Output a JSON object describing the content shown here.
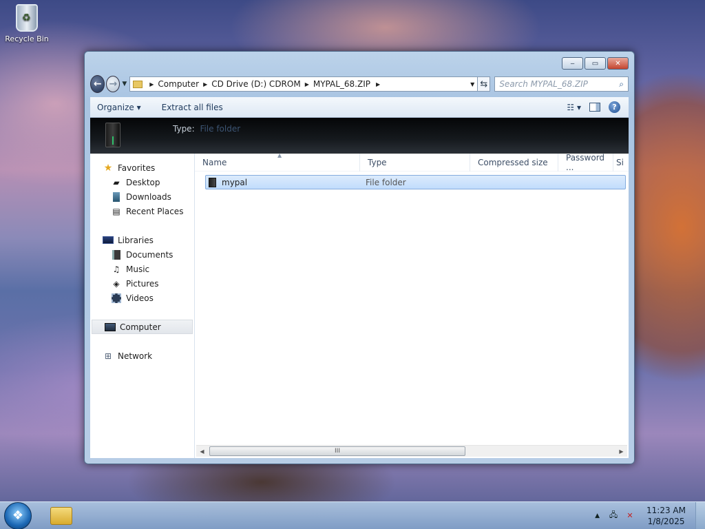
{
  "desktop": {
    "icons": [
      {
        "label": "Recycle Bin",
        "icon": "recycle-bin-icon"
      }
    ]
  },
  "window": {
    "controls": {
      "minimize": "‒",
      "maximize": "▭",
      "close": "✕"
    },
    "nav": {
      "back_glyph": "←",
      "forward_glyph": "→",
      "history_glyph": "▼"
    },
    "address": {
      "crumbs": [
        "Computer",
        "CD Drive (D:) CDROM",
        "MYPAL_68.ZIP"
      ],
      "separator": "▶",
      "dropdown_glyph": "▼",
      "refresh_glyph": "⇆"
    },
    "search": {
      "placeholder": "Search MYPAL_68.ZIP",
      "icon_glyph": "⌕"
    },
    "toolbar": {
      "organize": "Organize ▾",
      "extract": "Extract all files",
      "view_glyph": "☷ ▾",
      "help_glyph": "?"
    },
    "details_banner": {
      "label": "Type:",
      "value": "File folder"
    },
    "navpane": {
      "favorites": {
        "label": "Favorites",
        "items": [
          "Desktop",
          "Downloads",
          "Recent Places"
        ]
      },
      "libraries": {
        "label": "Libraries",
        "items": [
          "Documents",
          "Music",
          "Pictures",
          "Videos"
        ]
      },
      "computer": "Computer",
      "network": "Network"
    },
    "columns": [
      "Name",
      "Type",
      "Compressed size",
      "Password ...",
      "Si"
    ],
    "files": [
      {
        "name": "mypal",
        "type": "File folder"
      }
    ],
    "scrollbar": {
      "left": "◀",
      "right": "▶",
      "grip": "III"
    }
  },
  "taskbar": {
    "start_glyph": "❖",
    "tray": {
      "up_glyph": "▲",
      "network_glyph": "🖧",
      "volume_glyph": "✕"
    },
    "clock": {
      "time": "11:23 AM",
      "date": "1/8/2025"
    }
  },
  "colors": {
    "selection": "#c1dcfc",
    "banner": "#050608",
    "taskbar": "#accae0"
  }
}
